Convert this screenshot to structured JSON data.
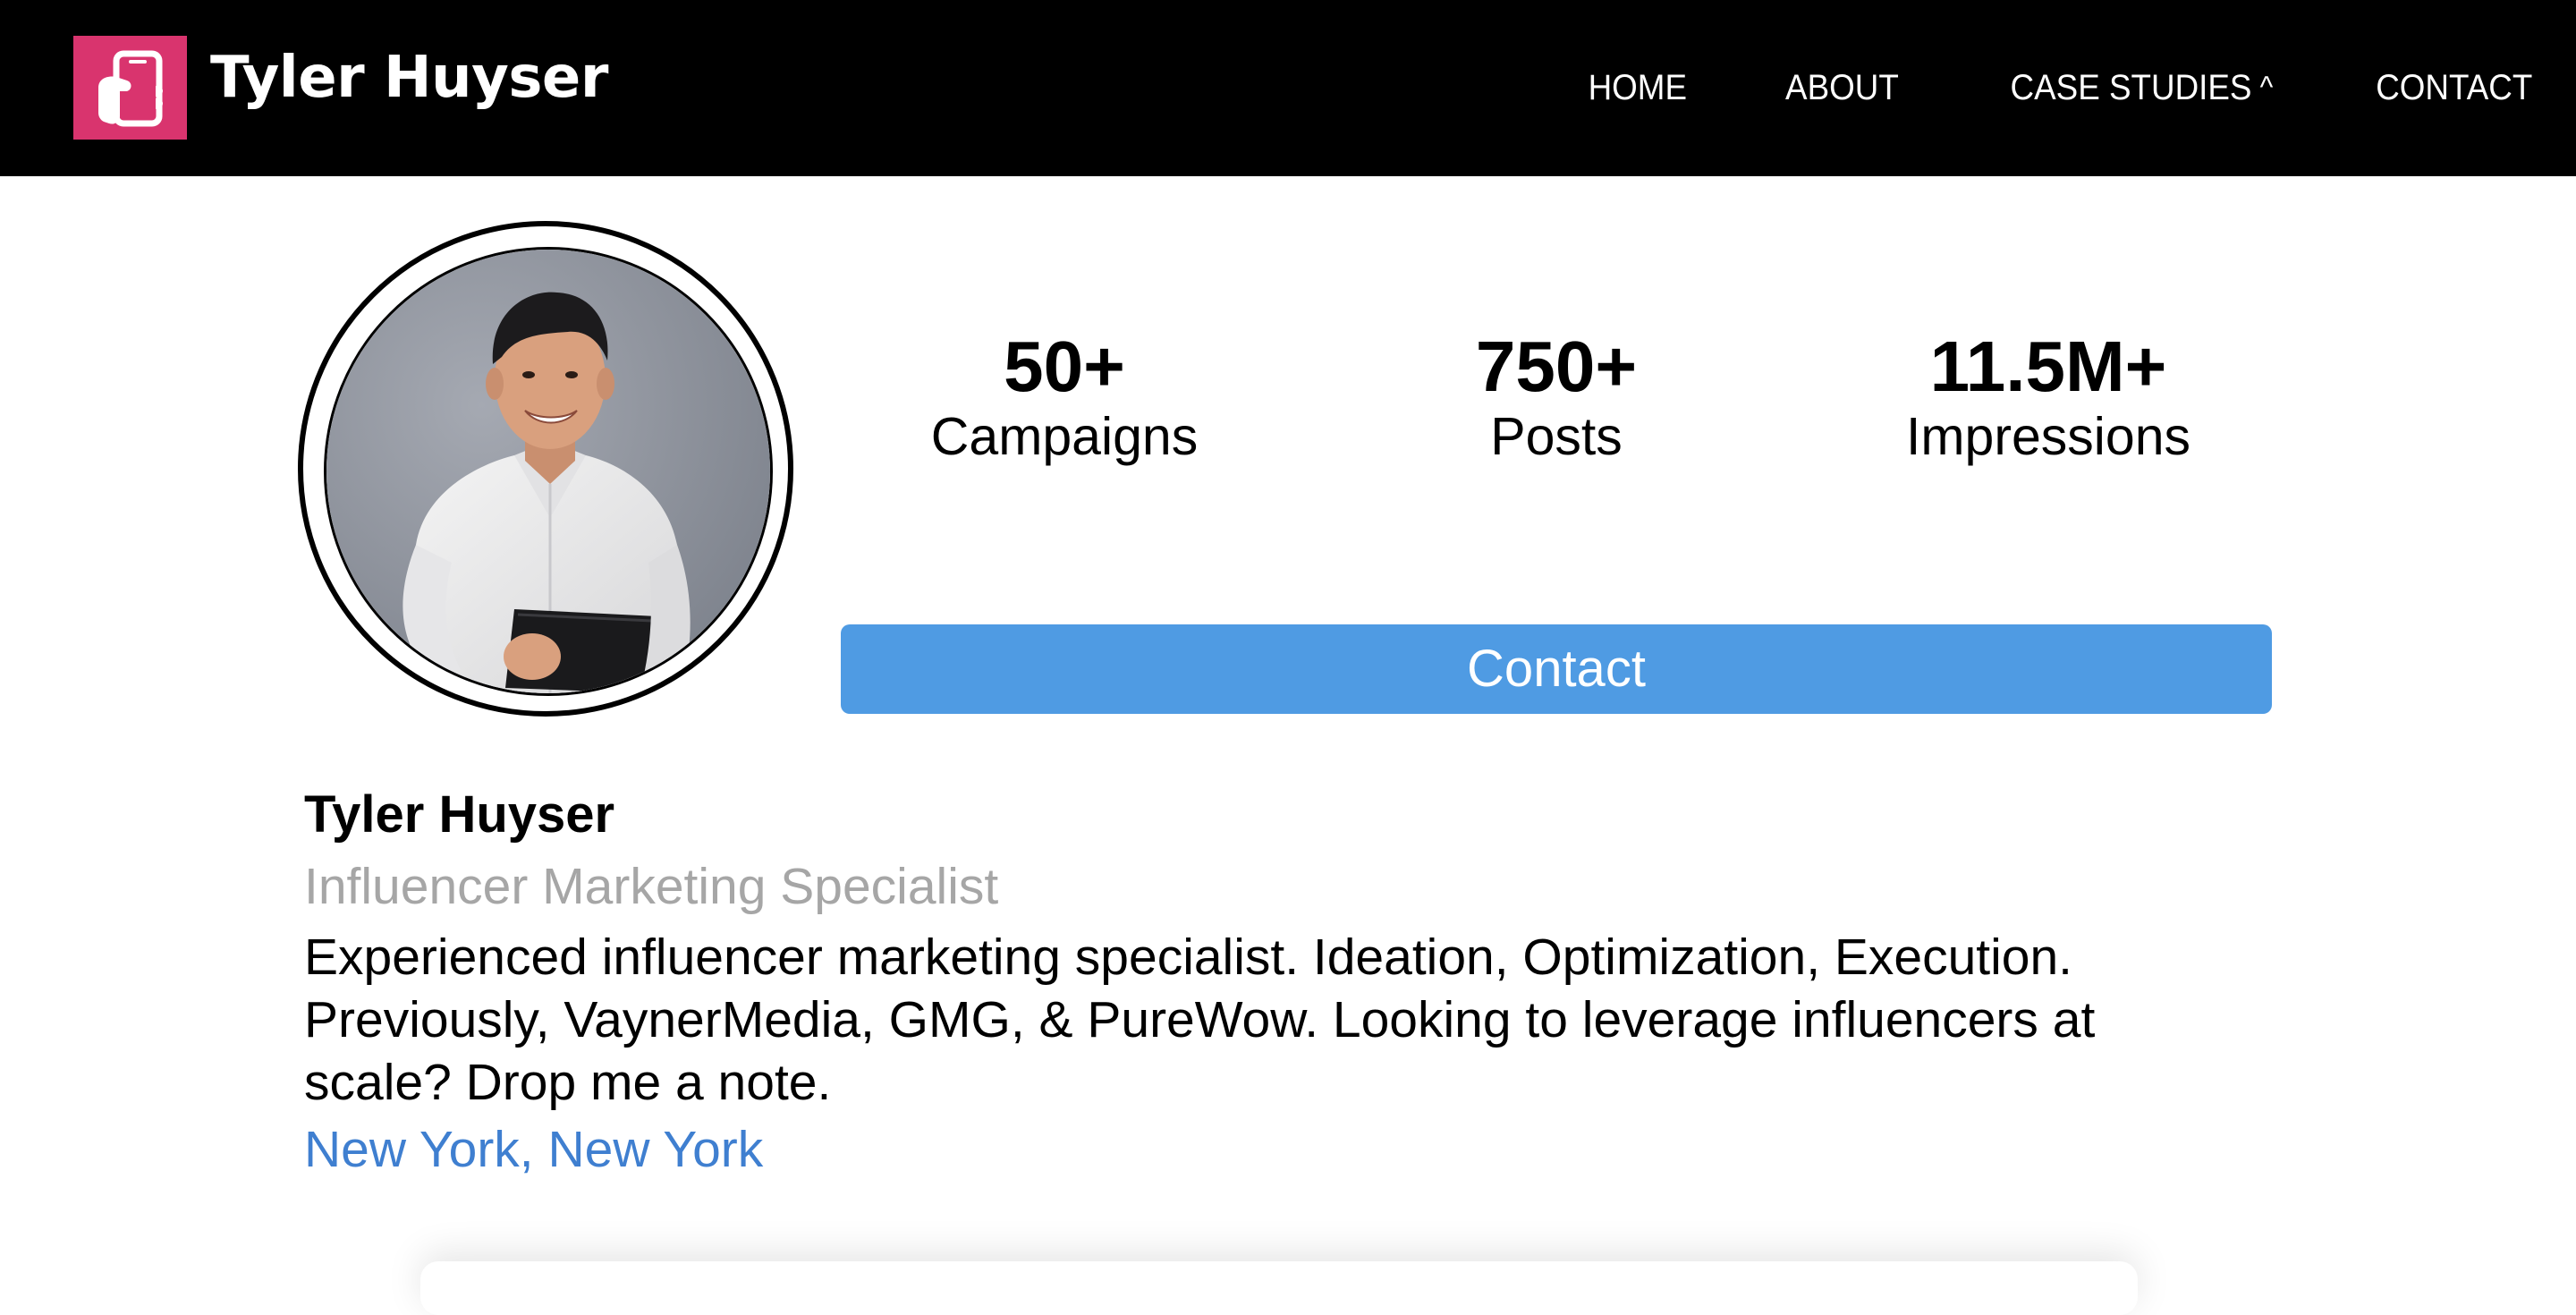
{
  "brand": {
    "name": "Tyler Huyser",
    "logo_icon": "hand-holding-phone-icon",
    "accent_color": "#d9346e"
  },
  "nav": {
    "items": [
      {
        "label": "HOME"
      },
      {
        "label": "ABOUT"
      },
      {
        "label": "CASE STUDIES",
        "caret": "^"
      },
      {
        "label": "CONTACT"
      }
    ]
  },
  "profile": {
    "avatar_alt": "profile-photo",
    "stats": [
      {
        "value": "50+",
        "label": "Campaigns"
      },
      {
        "value": "750+",
        "label": "Posts"
      },
      {
        "value": "11.5M+",
        "label": "Impressions"
      }
    ],
    "contact_label": "Contact",
    "contact_color": "#4f9be3",
    "name": "Tyler Huyser",
    "title": "Influencer Marketing Specialist",
    "bio_lines": [
      "Experienced influencer marketing specialist. Ideation, Optimization, Execution.",
      "Previously, VaynerMedia, GMG, & PureWow. Looking to leverage influencers at",
      "scale? Drop me a note."
    ],
    "location": "New York, New York",
    "location_color": "#3f7fd0"
  }
}
